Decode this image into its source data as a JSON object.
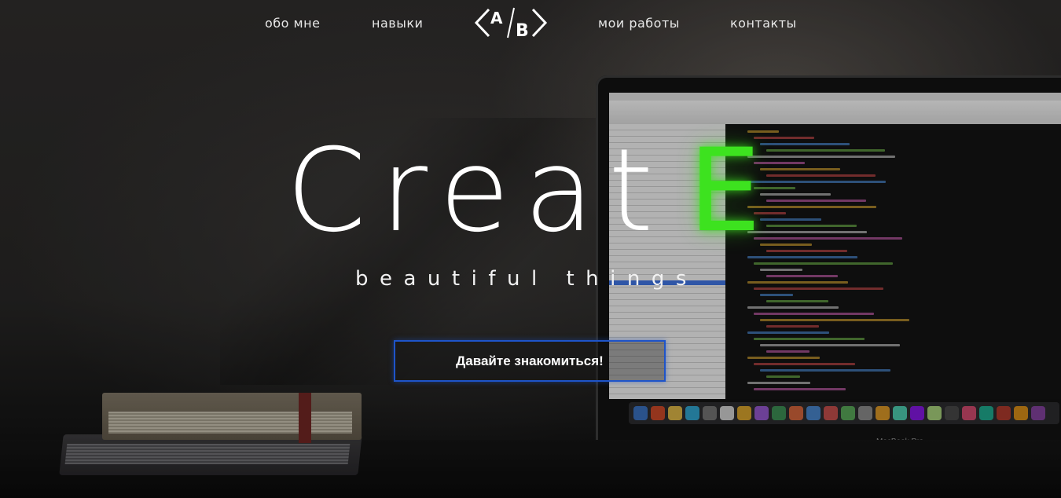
{
  "nav": {
    "items": [
      {
        "label": "обо мне"
      },
      {
        "label": "навыки"
      },
      {
        "label": "мои работы"
      },
      {
        "label": "контакты"
      }
    ],
    "logo": {
      "left": "A",
      "right": "B"
    }
  },
  "hero": {
    "title_main": "Creat",
    "title_accent": "E",
    "accent_color": "#3de21f",
    "subtitle": "beautiful things",
    "cta_label": "Давайте знакомиться!"
  },
  "laptop": {
    "brand_label": "MacBook Pro"
  }
}
